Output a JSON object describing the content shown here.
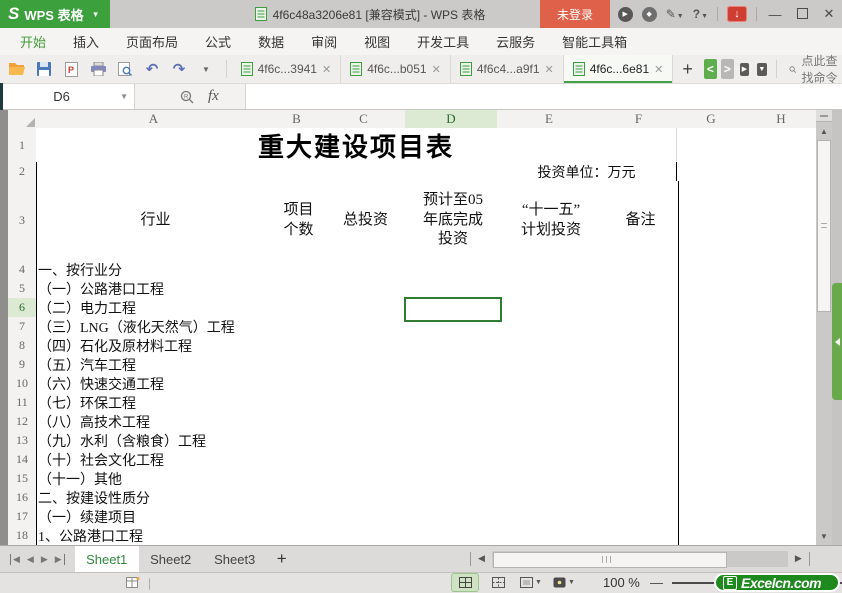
{
  "window": {
    "logo_s": "S",
    "app_name": "WPS 表格",
    "title": "4f6c48a3206e81 [兼容模式] - WPS 表格",
    "login": "未登录"
  },
  "menu": {
    "items": [
      "开始",
      "插入",
      "页面布局",
      "公式",
      "数据",
      "审阅",
      "视图",
      "开发工具",
      "云服务",
      "智能工具箱"
    ],
    "active_index": 0
  },
  "doc_tabs": {
    "tabs": [
      {
        "label": "4f6c...3941",
        "active": false
      },
      {
        "label": "4f6c...b051",
        "active": false
      },
      {
        "label": "4f6c4...a9f1",
        "active": false
      },
      {
        "label": "4f6c...6e81",
        "active": true
      }
    ],
    "find_hint": "点此查找命令"
  },
  "formula_bar": {
    "cell_ref": "D6",
    "fx": "fx",
    "value": ""
  },
  "sheet": {
    "columns": [
      "A",
      "B",
      "C",
      "D",
      "E",
      "F",
      "G",
      "H"
    ],
    "selected_column": "D",
    "selected_row": 6,
    "selected_cell": "D6",
    "title": "重大建设项目表",
    "unit_note": "投资单位：万元",
    "col_headers": [
      "行业",
      "项目\n个数",
      "总投资",
      "预计至05\n年底完成\n投资",
      "“十一五”\n计划投资",
      "备注"
    ],
    "body_rows": [
      {
        "row": 4,
        "label": "一、按行业分"
      },
      {
        "row": 5,
        "label": "（一）公路港口工程"
      },
      {
        "row": 6,
        "label": "（二）电力工程"
      },
      {
        "row": 7,
        "label": "（三）LNG（液化天然气）工程"
      },
      {
        "row": 8,
        "label": "（四）石化及原材料工程"
      },
      {
        "row": 9,
        "label": "（五）汽车工程"
      },
      {
        "row": 10,
        "label": "（六）快速交通工程"
      },
      {
        "row": 11,
        "label": "（七）环保工程"
      },
      {
        "row": 12,
        "label": "（八）高技术工程"
      },
      {
        "row": 13,
        "label": "（九）水利（含粮食）工程"
      },
      {
        "row": 14,
        "label": "（十）社会文化工程"
      },
      {
        "row": 15,
        "label": "（十一）其他"
      },
      {
        "row": 16,
        "label": "二、按建设性质分"
      },
      {
        "row": 17,
        "label": "（一）续建项目"
      },
      {
        "row": 18,
        "label": "1、公路港口工程"
      }
    ]
  },
  "sheet_tabs": {
    "tabs": [
      {
        "label": "Sheet1",
        "active": true
      },
      {
        "label": "Sheet2",
        "active": false
      },
      {
        "label": "Sheet3",
        "active": false
      }
    ]
  },
  "status_bar": {
    "zoom": "100 %",
    "brand_letter": "E",
    "brand": "Excelcn.com"
  },
  "colors": {
    "wps_green": "#3ca03c",
    "accent_green": "#43a047",
    "selection_green": "#2e7d32",
    "login_red": "#df6149",
    "brand_green": "#1e8a1e",
    "table_border": "#000000"
  }
}
